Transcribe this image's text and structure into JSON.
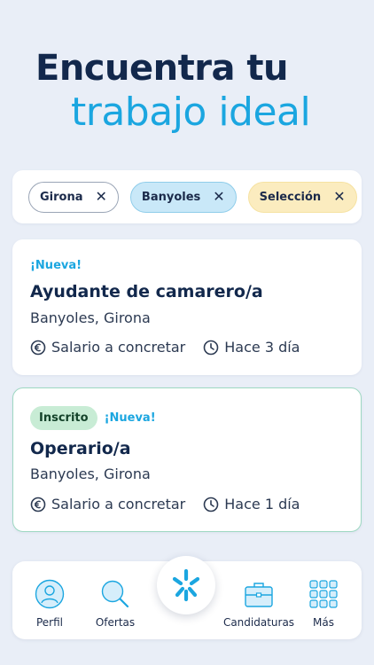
{
  "hero": {
    "line1": "Encuentra tu",
    "line2": "trabajo ideal"
  },
  "filters": [
    {
      "label": "Girona",
      "remove": "✕"
    },
    {
      "label": "Banyoles",
      "remove": "✕"
    },
    {
      "label": "Selección",
      "remove": "✕"
    }
  ],
  "jobs": [
    {
      "tag_new": "¡Nueva!",
      "title": "Ayudante de camarero/a",
      "location": "Banyoles, Girona",
      "salary": "Salario a concretar",
      "posted": "Hace 3 día"
    },
    {
      "badge": "Inscrito",
      "tag_new": "¡Nueva!",
      "title": "Operario/a",
      "location": "Banyoles, Girona",
      "salary": "Salario a concretar",
      "posted": "Hace 1 día"
    }
  ],
  "nav": {
    "profile": "Perfil",
    "offers": "Ofertas",
    "applications": "Candidaturas",
    "more": "Más"
  },
  "colors": {
    "background": "#e9eef7",
    "brand_navy": "#12284c",
    "accent_blue": "#1ba6e0",
    "applied_green": "#c8ecd5"
  },
  "icons": {
    "salary": "euro-icon",
    "posted": "clock-icon",
    "profile": "user-icon",
    "offers": "search-icon",
    "applications": "briefcase-icon",
    "more": "grid-icon",
    "fab": "sparkle-logo-icon"
  }
}
